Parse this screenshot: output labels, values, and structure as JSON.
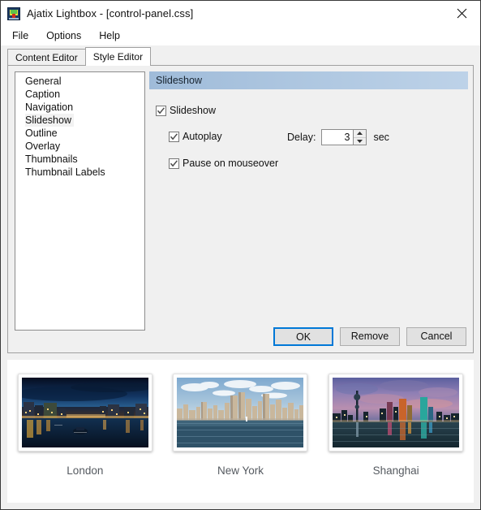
{
  "window": {
    "title": "Ajatix Lightbox - [control-panel.css]",
    "icon": "app-logo-icon",
    "close_label": "✕"
  },
  "menubar": {
    "items": [
      {
        "label": "File"
      },
      {
        "label": "Options"
      },
      {
        "label": "Help"
      }
    ]
  },
  "tabs": [
    {
      "label": "Content Editor",
      "active": false
    },
    {
      "label": "Style Editor",
      "active": true
    }
  ],
  "style_list": {
    "items": [
      {
        "label": "General",
        "selected": false
      },
      {
        "label": "Caption",
        "selected": false
      },
      {
        "label": "Navigation",
        "selected": false
      },
      {
        "label": "Slideshow",
        "selected": true
      },
      {
        "label": "Outline",
        "selected": false
      },
      {
        "label": "Overlay",
        "selected": false
      },
      {
        "label": "Thumbnails",
        "selected": false
      },
      {
        "label": "Thumbnail Labels",
        "selected": false
      }
    ]
  },
  "settings": {
    "section_title": "Slideshow",
    "slideshow": {
      "label": "Slideshow",
      "checked": true
    },
    "autoplay": {
      "label": "Autoplay",
      "checked": true
    },
    "pause_on_mouseover": {
      "label": "Pause on mouseover",
      "checked": true
    },
    "delay": {
      "label": "Delay:",
      "value": "3",
      "unit": "sec"
    }
  },
  "dialog_buttons": [
    {
      "label": "OK",
      "default": true
    },
    {
      "label": "Remove",
      "default": false
    },
    {
      "label": "Cancel",
      "default": false
    }
  ],
  "gallery": {
    "items": [
      {
        "caption": "London",
        "image": "london-night-skyline-thumbnail"
      },
      {
        "caption": "New York",
        "image": "new-york-daytime-skyline-thumbnail"
      },
      {
        "caption": "Shanghai",
        "image": "shanghai-dusk-skyline-thumbnail"
      }
    ]
  },
  "colors": {
    "accent": "#0078d7",
    "section_header_start": "#9fbbd9",
    "section_header_end": "#bdd2e8",
    "window_bg": "#f0f0f0"
  }
}
